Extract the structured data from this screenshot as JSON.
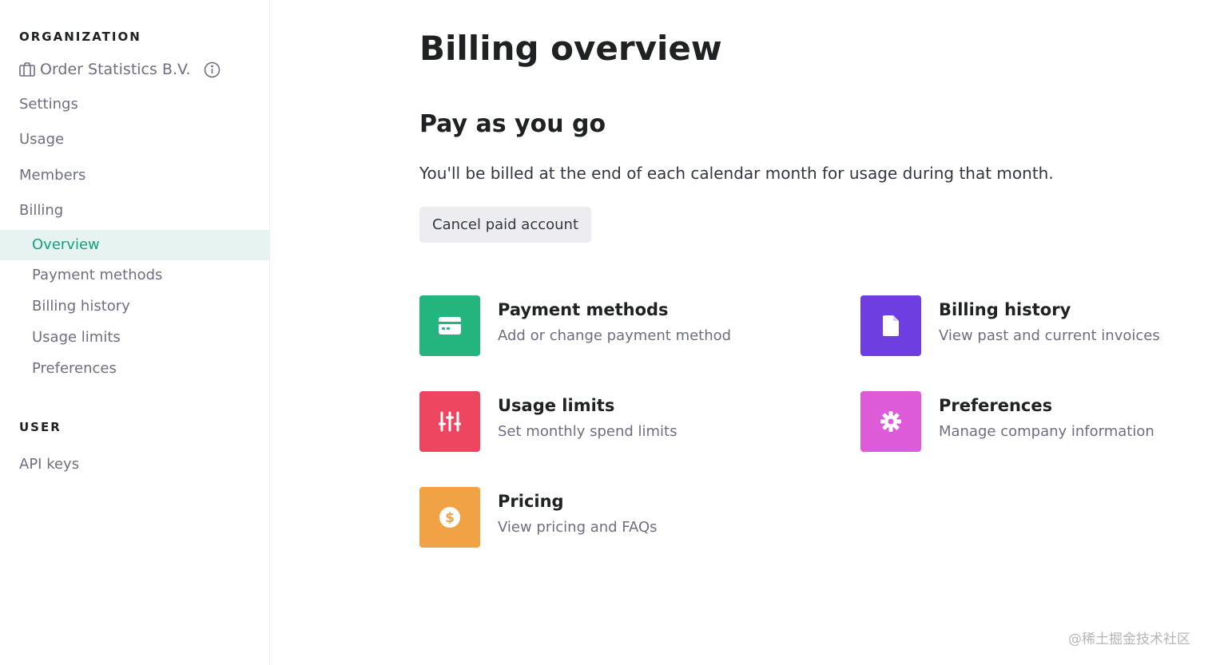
{
  "sidebar": {
    "org_heading": "ORGANIZATION",
    "org_name": "Order Statistics B.V.",
    "items": {
      "settings": "Settings",
      "usage": "Usage",
      "members": "Members",
      "billing": "Billing"
    },
    "billing_sub": {
      "overview": "Overview",
      "payment_methods": "Payment methods",
      "billing_history": "Billing history",
      "usage_limits": "Usage limits",
      "preferences": "Preferences"
    },
    "user_heading": "USER",
    "api_keys": "API keys",
    "active_item": "Overview"
  },
  "main": {
    "title": "Billing overview",
    "plan_title": "Pay as you go",
    "plan_description": "You'll be billed at the end of each calendar month for usage during that month.",
    "cancel_label": "Cancel paid account",
    "cards": {
      "payment": {
        "title": "Payment methods",
        "subtitle": "Add or change payment method",
        "icon": "credit-card-icon",
        "color": "#24b47e"
      },
      "history": {
        "title": "Billing history",
        "subtitle": "View past and current invoices",
        "icon": "document-icon",
        "color": "#6e3ee0"
      },
      "limits": {
        "title": "Usage limits",
        "subtitle": "Set monthly spend limits",
        "icon": "sliders-icon",
        "color": "#ee4560"
      },
      "preferences": {
        "title": "Preferences",
        "subtitle": "Manage company information",
        "icon": "gear-icon",
        "color": "#dd5ad8"
      },
      "pricing": {
        "title": "Pricing",
        "subtitle": "View pricing and FAQs",
        "icon": "dollar-icon",
        "color": "#f0a244"
      }
    }
  },
  "colors": {
    "accent": "#10a37f",
    "active_bg": "#e6f3f1"
  },
  "watermark": "@稀土掘金技术社区"
}
